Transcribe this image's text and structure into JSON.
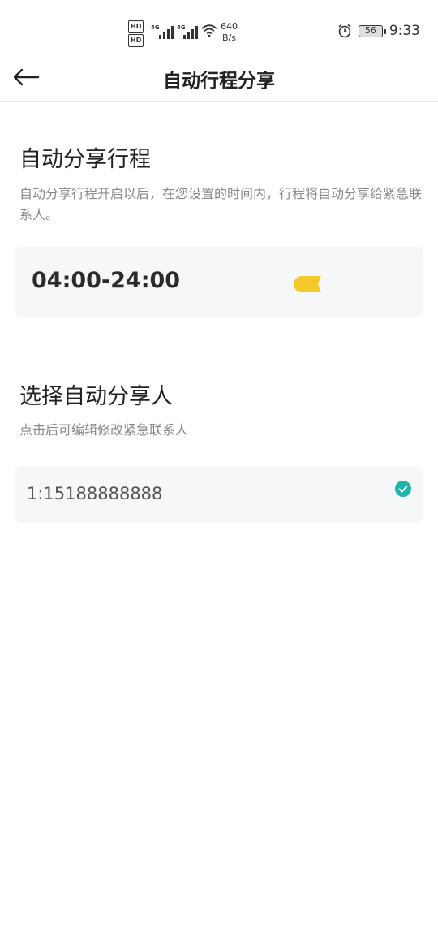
{
  "status_bar": {
    "hd1": "HD",
    "hd2": "HD",
    "net1": "4G",
    "net2": "4G",
    "speed_value": "640",
    "speed_unit": "B/s",
    "battery": "56",
    "time": "9:33"
  },
  "nav": {
    "title": "自动行程分享",
    "back_icon": "arrow-left-icon"
  },
  "auto_share": {
    "title": "自动分享行程",
    "description": "自动分享行程开启以后，在您设置的时间内，行程将自动分享给紧急联系人。",
    "time_range": "04:00-24:00",
    "toggle_color": "#f5c92a"
  },
  "share_person": {
    "title": "选择自动分享人",
    "description": "点击后可编辑修改紧急联系人",
    "contact": "1:15188888888",
    "check_color": "#1fb5ac"
  }
}
